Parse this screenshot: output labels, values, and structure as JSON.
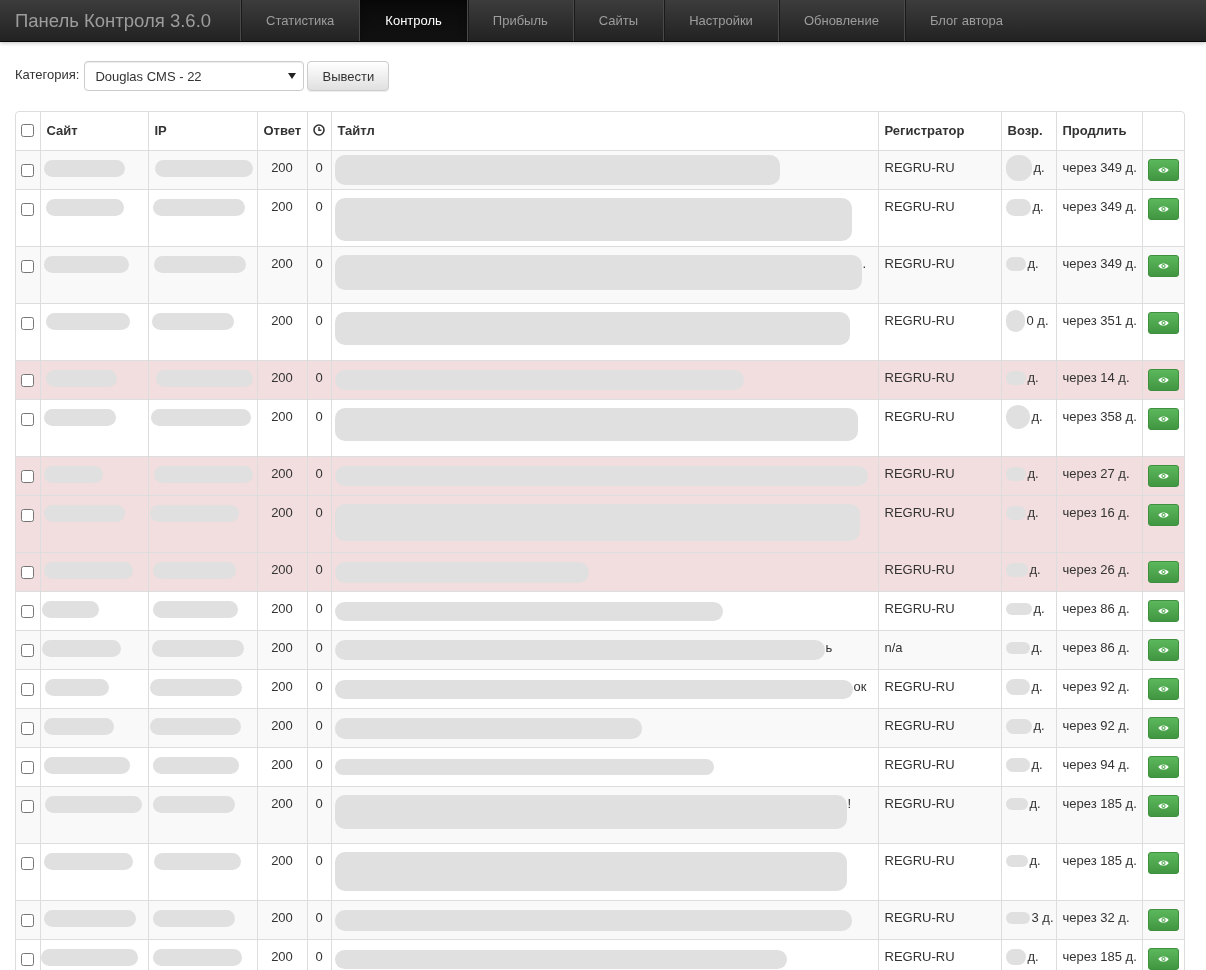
{
  "navbar": {
    "brand": "Панель Контроля 3.6.0",
    "items": [
      {
        "label": "Статистика",
        "selected": false
      },
      {
        "label": "Контроль",
        "selected": true
      },
      {
        "label": "Прибыль",
        "selected": false
      },
      {
        "label": "Сайты",
        "selected": false
      },
      {
        "label": "Настройки",
        "selected": false
      },
      {
        "label": "Обновление",
        "selected": false
      },
      {
        "label": "Блог автора",
        "selected": false
      }
    ]
  },
  "filter": {
    "label": "Категория:",
    "category": "Douglas CMS - 22",
    "button": "Вывести"
  },
  "table": {
    "columns": [
      {
        "kind": "checkbox",
        "checked": false
      },
      {
        "kind": "text",
        "label": "Сайт"
      },
      {
        "kind": "text",
        "label": "IP"
      },
      {
        "kind": "text",
        "label": "Ответ"
      },
      {
        "kind": "icon"
      },
      {
        "kind": "text",
        "label": "Тайтл"
      },
      {
        "kind": "text",
        "label": "Регистратор"
      },
      {
        "kind": "text",
        "label": "Возр."
      },
      {
        "kind": "text",
        "label": "Продлить"
      },
      {
        "kind": "blank"
      }
    ],
    "rows": [
      {
        "checked": false,
        "highlighted": false,
        "response": "200",
        "time": "0",
        "registrar": "REGRU-RU",
        "age": "д.",
        "renew": "через 349 д."
      },
      {
        "checked": false,
        "highlighted": false,
        "response": "200",
        "time": "0",
        "registrar": "REGRU-RU",
        "age": "д.",
        "renew": "через 349 д."
      },
      {
        "checked": false,
        "highlighted": false,
        "response": "200",
        "time": "0",
        "title_tail": ".",
        "registrar": "REGRU-RU",
        "age": "д.",
        "renew": "через 349 д."
      },
      {
        "checked": false,
        "highlighted": false,
        "response": "200",
        "time": "0",
        "registrar": "REGRU-RU",
        "age": "0 д.",
        "renew": "через 351 д."
      },
      {
        "checked": false,
        "highlighted": true,
        "response": "200",
        "time": "0",
        "registrar": "REGRU-RU",
        "age": "д.",
        "renew": "через 14 д."
      },
      {
        "checked": false,
        "highlighted": false,
        "response": "200",
        "time": "0",
        "registrar": "REGRU-RU",
        "age": "д.",
        "renew": "через 358 д."
      },
      {
        "checked": false,
        "highlighted": true,
        "response": "200",
        "time": "0",
        "registrar": "REGRU-RU",
        "age": "д.",
        "renew": "через 27 д."
      },
      {
        "checked": false,
        "highlighted": true,
        "response": "200",
        "time": "0",
        "registrar": "REGRU-RU",
        "age": "д.",
        "renew": "через 16 д."
      },
      {
        "checked": false,
        "highlighted": true,
        "response": "200",
        "time": "0",
        "registrar": "REGRU-RU",
        "age": "д.",
        "renew": "через 26 д."
      },
      {
        "checked": false,
        "highlighted": false,
        "response": "200",
        "time": "0",
        "registrar": "REGRU-RU",
        "age": "д.",
        "renew": "через 86 д."
      },
      {
        "checked": false,
        "highlighted": false,
        "response": "200",
        "time": "0",
        "title_tail": "ь",
        "registrar": "n/a",
        "age": "д.",
        "renew": "через 86 д."
      },
      {
        "checked": false,
        "highlighted": false,
        "response": "200",
        "time": "0",
        "title_tail": "ок",
        "registrar": "REGRU-RU",
        "age": "д.",
        "renew": "через 92 д."
      },
      {
        "checked": false,
        "highlighted": false,
        "response": "200",
        "time": "0",
        "registrar": "REGRU-RU",
        "age": "д.",
        "renew": "через 92 д."
      },
      {
        "checked": false,
        "highlighted": false,
        "response": "200",
        "time": "0",
        "registrar": "REGRU-RU",
        "age": "д.",
        "renew": "через 94 д."
      },
      {
        "checked": false,
        "highlighted": false,
        "response": "200",
        "time": "0",
        "title_tail": "!",
        "registrar": "REGRU-RU",
        "age": "д.",
        "renew": "через 185 д."
      },
      {
        "checked": false,
        "highlighted": false,
        "response": "200",
        "time": "0",
        "registrar": "REGRU-RU",
        "age": "д.",
        "renew": "через 185 д."
      },
      {
        "checked": false,
        "highlighted": false,
        "response": "200",
        "time": "0",
        "registrar": "REGRU-RU",
        "age": "3 д.",
        "renew": "через 32 д."
      },
      {
        "checked": false,
        "highlighted": false,
        "response": "200",
        "time": "0",
        "registrar": "REGRU-RU",
        "age": "д.",
        "renew": "через 185 д."
      }
    ]
  }
}
